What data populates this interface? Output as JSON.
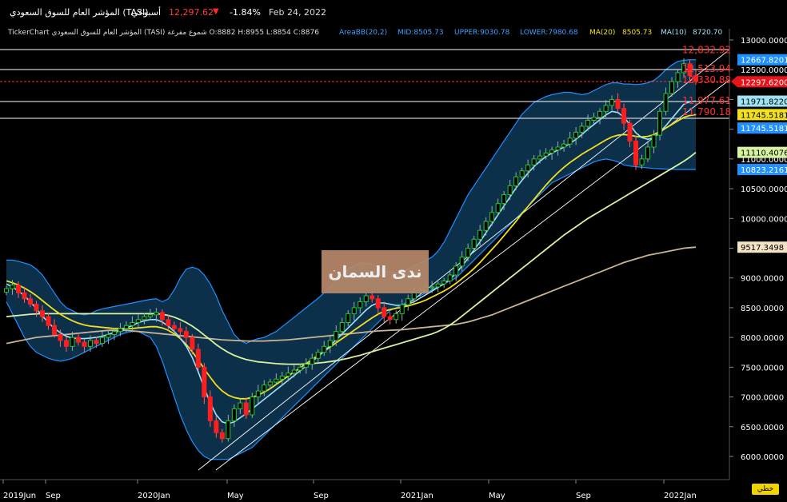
{
  "header": {
    "title": "المؤشر العام للسوق السعودي (TASI)",
    "period": "أسبوعي",
    "price": "12,297.62",
    "change": "-1.84%",
    "date": "Feb 24, 2022",
    "down_color": "#ff2a2a"
  },
  "infobar": {
    "ohlc": "TickerChart المؤشر العام للسوق السعودي (TASI) شموع مفرغة O:8882 H:8955 L:8854 C:8876",
    "bb": "AreaBB(20,2)",
    "mid": "MID:8505.73",
    "upper": "UPPER:9030.78",
    "lower": "LOWER:7980.68",
    "ma20_label": "MA(20)",
    "ma20_value": "8505.73",
    "ma10_label": "MA(10)",
    "ma10_value": "8720.70"
  },
  "watermark": "ندى السمان",
  "tool_button": "خطي",
  "chart_data": {
    "type": "candlestick",
    "x_ticks": [
      "2019Jun",
      "Sep",
      "2020Jan",
      "May",
      "Sep",
      "2021Jan",
      "May",
      "Sep",
      "2022Jan"
    ],
    "y_ticks": [
      "13000.0000",
      "12500.0000",
      "12000.0000",
      "11500.0000",
      "11000.0000",
      "10500.0000",
      "10000.0000",
      "9500.0000",
      "9000.0000",
      "8500.0000",
      "8000.0000",
      "7500.0000",
      "7000.0000",
      "6500.0000",
      "6000.0000"
    ],
    "ylim": [
      5800,
      13050
    ],
    "horizontal_lines": [
      {
        "label": "12,832.92",
        "value": 12832.92,
        "color": "#ff3030"
      },
      {
        "label": "12,513.94",
        "value": 12513.94,
        "color": "#ff3030"
      },
      {
        "label": "12,330.88",
        "value": 12330.88,
        "color": "#ff3030"
      },
      {
        "label": "11,977.61",
        "value": 11977.61,
        "color": "#ff3030"
      },
      {
        "label": "11,790.18",
        "value": 11790.18,
        "color": "#ff3030"
      }
    ],
    "price_tags": [
      {
        "label": "12667.8201",
        "value": 12667.82,
        "bg": "#1e90ff",
        "fg": "#ffffff"
      },
      {
        "label": "12297.6200",
        "value": 12297.62,
        "bg": "#e8141b",
        "fg": "#ffffff"
      },
      {
        "label": "11971.8220",
        "value": 11971.82,
        "bg": "#9fe3f2",
        "fg": "#000000"
      },
      {
        "label": "11745.5181",
        "value": 11745.52,
        "bg": "#f0e020",
        "fg": "#000000"
      },
      {
        "label": "11745.5181",
        "value": 11520.0,
        "bg": "#1e90ff",
        "fg": "#ffffff"
      },
      {
        "label": "11110.4076",
        "value": 11110.41,
        "bg": "#d7f2a0",
        "fg": "#000000"
      },
      {
        "label": "10823.2161",
        "value": 10823.22,
        "bg": "#1e90ff",
        "fg": "#ffffff"
      },
      {
        "label": "9517.3498",
        "value": 9517.35,
        "bg": "#f4e3c4",
        "fg": "#000000"
      }
    ],
    "close": [
      8820,
      8880,
      8750,
      8650,
      8560,
      8450,
      8350,
      8200,
      8050,
      7950,
      7850,
      8000,
      7920,
      7850,
      7950,
      7900,
      8000,
      8050,
      8100,
      8150,
      8200,
      8250,
      8300,
      8350,
      8380,
      8420,
      8300,
      8200,
      8150,
      8100,
      8000,
      7800,
      7500,
      7000,
      6600,
      6400,
      6300,
      6600,
      6800,
      6900,
      6700,
      7000,
      7100,
      7200,
      7250,
      7300,
      7350,
      7400,
      7450,
      7500,
      7550,
      7650,
      7750,
      7850,
      7950,
      8100,
      8250,
      8400,
      8500,
      8600,
      8700,
      8650,
      8500,
      8350,
      8300,
      8400,
      8550,
      8650,
      8750,
      8800,
      8850,
      8850,
      8900,
      8950,
      9050,
      9200,
      9350,
      9500,
      9650,
      9800,
      9950,
      10100,
      10250,
      10400,
      10550,
      10700,
      10800,
      10900,
      11000,
      11050,
      11100,
      11150,
      11200,
      11250,
      11350,
      11450,
      11550,
      11650,
      11700,
      11800,
      11900,
      12000,
      11850,
      11600,
      11300,
      10900,
      11000,
      11200,
      11400,
      11800,
      12100,
      12300,
      12450,
      12600,
      12400,
      12300
    ],
    "bb_upper": [
      9300,
      9300,
      9280,
      9250,
      9220,
      9150,
      9050,
      8900,
      8750,
      8600,
      8500,
      8450,
      8400,
      8380,
      8400,
      8450,
      8480,
      8500,
      8520,
      8540,
      8560,
      8580,
      8600,
      8620,
      8640,
      8650,
      8600,
      8650,
      8800,
      9000,
      9150,
      9180,
      9150,
      9050,
      8900,
      8700,
      8450,
      8250,
      8050,
      7950,
      7900,
      7950,
      7980,
      8000,
      8050,
      8100,
      8180,
      8260,
      8340,
      8420,
      8500,
      8580,
      8660,
      8750,
      8850,
      8950,
      9050,
      9150,
      9200,
      9250,
      9250,
      9230,
      9180,
      9120,
      9100,
      9080,
      9100,
      9150,
      9200,
      9250,
      9300,
      9350,
      9450,
      9600,
      9800,
      10000,
      10200,
      10400,
      10550,
      10700,
      10850,
      11000,
      11150,
      11300,
      11450,
      11600,
      11750,
      11850,
      11950,
      12000,
      12050,
      12080,
      12100,
      12120,
      12120,
      12100,
      12080,
      12100,
      12150,
      12200,
      12250,
      12280,
      12280,
      12260,
      12260,
      12250,
      12260,
      12280,
      12320,
      12400,
      12500,
      12580,
      12640,
      12660,
      12668,
      12668
    ],
    "bb_lower": [
      8600,
      8400,
      8200,
      8000,
      7850,
      7750,
      7700,
      7650,
      7620,
      7600,
      7620,
      7650,
      7700,
      7750,
      7800,
      7850,
      7900,
      7950,
      8000,
      8050,
      8080,
      8100,
      8100,
      8050,
      8000,
      7850,
      7600,
      7300,
      7000,
      6700,
      6450,
      6250,
      6100,
      6000,
      5950,
      5950,
      5950,
      5950,
      6000,
      6050,
      6100,
      6150,
      6250,
      6350,
      6450,
      6550,
      6650,
      6750,
      6850,
      6950,
      7050,
      7150,
      7250,
      7350,
      7450,
      7550,
      7650,
      7750,
      7850,
      7950,
      8050,
      8150,
      8250,
      8350,
      8450,
      8500,
      8550,
      8600,
      8650,
      8700,
      8750,
      8800,
      8850,
      8900,
      8950,
      9000,
      9100,
      9200,
      9300,
      9400,
      9500,
      9600,
      9700,
      9800,
      9900,
      10000,
      10100,
      10200,
      10300,
      10400,
      10500,
      10600,
      10650,
      10700,
      10750,
      10800,
      10850,
      10900,
      10950,
      10980,
      11000,
      10980,
      10950,
      10900,
      10880,
      10870,
      10860,
      10850,
      10840,
      10835,
      10830,
      10826,
      10824,
      10823,
      10823,
      10823
    ],
    "ma10": [
      8900,
      8850,
      8780,
      8700,
      8600,
      8480,
      8360,
      8250,
      8150,
      8080,
      8020,
      7990,
      7980,
      7980,
      7990,
      8000,
      8020,
      8050,
      8080,
      8120,
      8160,
      8200,
      8250,
      8280,
      8300,
      8300,
      8260,
      8190,
      8100,
      7990,
      7850,
      7660,
      7420,
      7150,
      6900,
      6700,
      6580,
      6550,
      6580,
      6650,
      6720,
      6800,
      6880,
      6960,
      7040,
      7120,
      7200,
      7280,
      7360,
      7440,
      7520,
      7600,
      7680,
      7770,
      7860,
      7960,
      8060,
      8160,
      8260,
      8360,
      8460,
      8540,
      8580,
      8580,
      8560,
      8540,
      8540,
      8560,
      8600,
      8660,
      8720,
      8780,
      8840,
      8900,
      8980,
      9080,
      9200,
      9330,
      9470,
      9610,
      9760,
      9910,
      10060,
      10210,
      10360,
      10510,
      10640,
      10760,
      10870,
      10960,
      11040,
      11100,
      11150,
      11200,
      11260,
      11330,
      11410,
      11500,
      11580,
      11660,
      11740,
      11800,
      11780,
      11700,
      11580,
      11440,
      11360,
      11330,
      11360,
      11450,
      11560,
      11680,
      11800,
      11920,
      11960,
      11972
    ],
    "ma20": [
      8950,
      8920,
      8880,
      8830,
      8770,
      8700,
      8620,
      8540,
      8460,
      8390,
      8330,
      8280,
      8240,
      8210,
      8190,
      8180,
      8170,
      8160,
      8150,
      8150,
      8150,
      8150,
      8160,
      8170,
      8180,
      8180,
      8160,
      8120,
      8060,
      7980,
      7880,
      7760,
      7620,
      7470,
      7330,
      7200,
      7100,
      7030,
      6990,
      6970,
      6970,
      6990,
      7030,
      7080,
      7140,
      7210,
      7280,
      7350,
      7420,
      7490,
      7560,
      7630,
      7700,
      7770,
      7840,
      7910,
      7980,
      8050,
      8120,
      8190,
      8260,
      8330,
      8390,
      8440,
      8470,
      8490,
      8510,
      8530,
      8560,
      8590,
      8630,
      8680,
      8730,
      8780,
      8840,
      8910,
      8990,
      9070,
      9160,
      9260,
      9370,
      9480,
      9590,
      9710,
      9830,
      9950,
      10080,
      10200,
      10320,
      10440,
      10560,
      10670,
      10770,
      10860,
      10940,
      11010,
      11080,
      11140,
      11200,
      11260,
      11320,
      11370,
      11400,
      11410,
      11400,
      11380,
      11370,
      11380,
      11410,
      11460,
      11520,
      11580,
      11640,
      11700,
      11730,
      11745
    ],
    "ma_long1": [
      8350,
      8360,
      8370,
      8380,
      8390,
      8395,
      8400,
      8400,
      8400,
      8400,
      8400,
      8400,
      8400,
      8400,
      8400,
      8400,
      8400,
      8400,
      8400,
      8400,
      8400,
      8400,
      8400,
      8400,
      8400,
      8400,
      8390,
      8370,
      8340,
      8300,
      8250,
      8190,
      8120,
      8040,
      7960,
      7880,
      7810,
      7750,
      7700,
      7660,
      7630,
      7610,
      7590,
      7580,
      7570,
      7560,
      7555,
      7550,
      7550,
      7550,
      7555,
      7560,
      7570,
      7580,
      7595,
      7610,
      7630,
      7650,
      7675,
      7700,
      7730,
      7760,
      7790,
      7820,
      7850,
      7880,
      7910,
      7940,
      7970,
      8000,
      8030,
      8060,
      8100,
      8150,
      8210,
      8280,
      8360,
      8440,
      8520,
      8600,
      8680,
      8760,
      8840,
      8920,
      9000,
      9080,
      9160,
      9240,
      9320,
      9400,
      9480,
      9560,
      9640,
      9720,
      9790,
      9860,
      9930,
      10000,
      10060,
      10120,
      10180,
      10240,
      10300,
      10360,
      10420,
      10480,
      10540,
      10600,
      10660,
      10720,
      10780,
      10840,
      10900,
      10960,
      11030,
      11110
    ],
    "ma_long2": [
      7900,
      7920,
      7940,
      7960,
      7980,
      8000,
      8010,
      8020,
      8030,
      8040,
      8050,
      8060,
      8070,
      8080,
      8090,
      8100,
      8110,
      8120,
      8120,
      8120,
      8120,
      8110,
      8100,
      8090,
      8080,
      8070,
      8060,
      8050,
      8040,
      8030,
      8020,
      8010,
      8000,
      7990,
      7980,
      7970,
      7960,
      7955,
      7950,
      7945,
      7940,
      7940,
      7940,
      7940,
      7945,
      7950,
      7955,
      7960,
      7970,
      7980,
      7990,
      8000,
      8010,
      8020,
      8030,
      8040,
      8050,
      8060,
      8070,
      8080,
      8090,
      8100,
      8110,
      8115,
      8120,
      8125,
      8130,
      8140,
      8150,
      8160,
      8170,
      8180,
      8190,
      8200,
      8210,
      8220,
      8240,
      8260,
      8290,
      8320,
      8350,
      8380,
      8420,
      8460,
      8500,
      8540,
      8580,
      8620,
      8660,
      8700,
      8740,
      8780,
      8820,
      8860,
      8900,
      8940,
      8980,
      9020,
      9060,
      9100,
      9140,
      9180,
      9220,
      9260,
      9290,
      9320,
      9350,
      9380,
      9400,
      9420,
      9440,
      9460,
      9480,
      9500,
      9510,
      9517
    ]
  }
}
